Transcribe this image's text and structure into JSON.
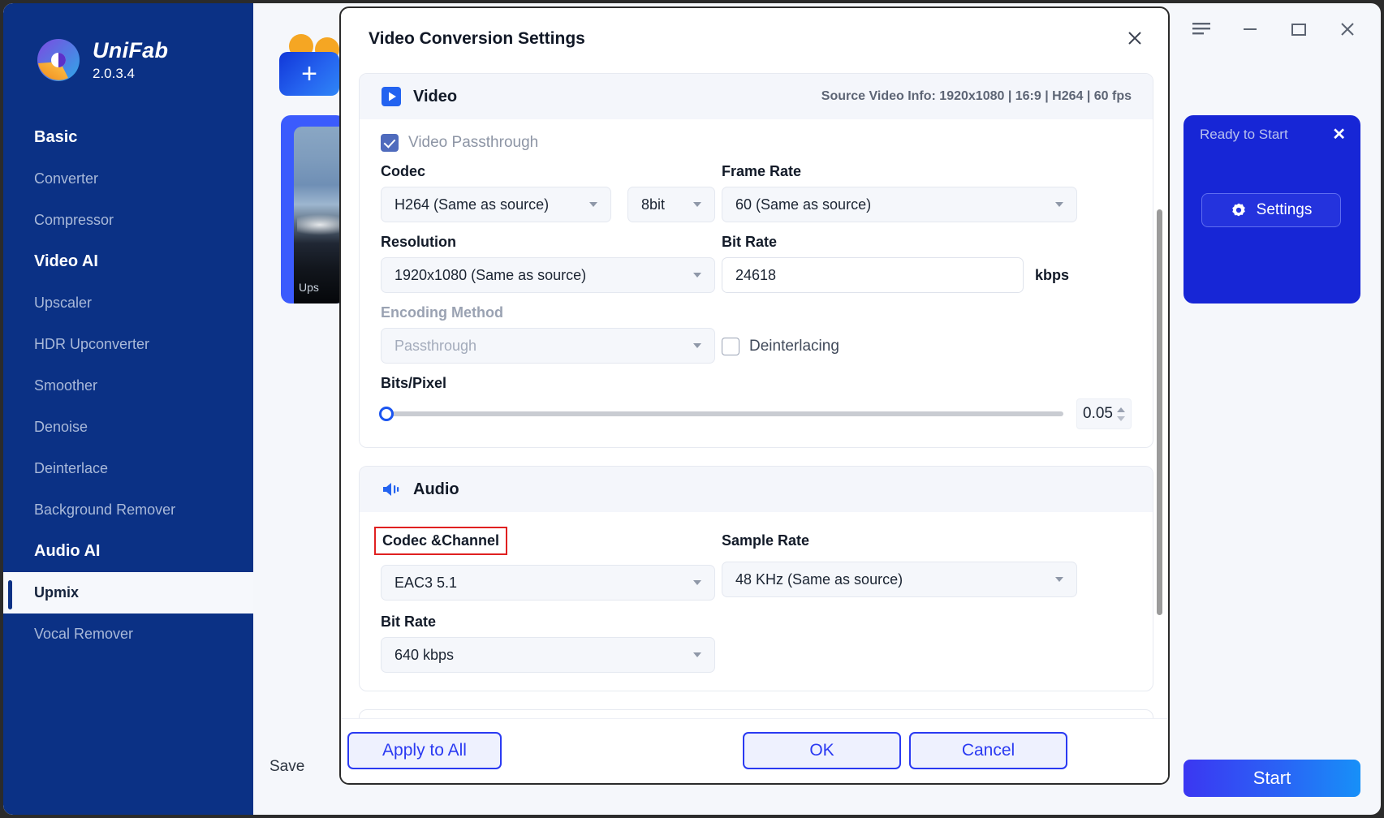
{
  "app": {
    "brand_name": "UniFab",
    "version": "2.0.3.4"
  },
  "titlebar": {
    "menu_icon": "hamburger-menu-icon",
    "minimize_icon": "minimize-icon",
    "maximize_icon": "maximize-icon",
    "close_icon": "close-icon"
  },
  "sidebar": {
    "groups": [
      {
        "label": "Basic",
        "items": [
          {
            "label": "Converter",
            "active": false
          },
          {
            "label": "Compressor",
            "active": false
          }
        ]
      },
      {
        "label": "Video AI",
        "items": [
          {
            "label": "Upscaler",
            "active": false
          },
          {
            "label": "HDR Upconverter",
            "active": false
          },
          {
            "label": "Smoother",
            "active": false
          },
          {
            "label": "Denoise",
            "active": false
          },
          {
            "label": "Deinterlace",
            "active": false
          },
          {
            "label": "Background Remover",
            "active": false
          }
        ]
      },
      {
        "label": "Audio AI",
        "items": [
          {
            "label": "Upmix",
            "active": true
          },
          {
            "label": "Vocal Remover",
            "active": false
          }
        ]
      }
    ]
  },
  "content": {
    "add_button_label": "+",
    "task_card_label": "Ups",
    "save_label": "Save",
    "ready_panel": {
      "title": "Ready to Start",
      "close_icon": "close-icon",
      "settings_label": "Settings",
      "settings_icon": "gear-icon"
    },
    "start_label": "Start"
  },
  "dialog": {
    "title": "Video Conversion Settings",
    "close_icon": "close-icon",
    "video": {
      "section_title": "Video",
      "section_icon": "video-play-icon",
      "source_info": "Source Video Info: 1920x1080 | 16:9 | H264 | 60 fps",
      "passthrough_label": "Video Passthrough",
      "passthrough_checked": true,
      "codec_label": "Codec",
      "codec_value": "H264 (Same as source)",
      "bitdepth_value": "8bit",
      "framerate_label": "Frame Rate",
      "framerate_value": "60 (Same as source)",
      "resolution_label": "Resolution",
      "resolution_value": "1920x1080 (Same as source)",
      "bitrate_label": "Bit Rate",
      "bitrate_value": "24618",
      "bitrate_unit": "kbps",
      "encoding_label": "Encoding Method",
      "encoding_value": "Passthrough",
      "deinterlacing_label": "Deinterlacing",
      "deinterlacing_checked": false,
      "bitspixel_label": "Bits/Pixel",
      "bitspixel_value": "0.05"
    },
    "audio": {
      "section_title": "Audio",
      "section_icon": "speaker-icon",
      "codec_channel_label": "Codec &Channel",
      "codec_channel_value": "EAC3 5.1",
      "sample_rate_label": "Sample Rate",
      "sample_rate_value": "48 KHz (Same as source)",
      "bitrate_label": "Bit Rate",
      "bitrate_value": "640 kbps"
    },
    "footer": {
      "apply_all_label": "Apply to All",
      "ok_label": "OK",
      "cancel_label": "Cancel"
    }
  },
  "colors": {
    "sidebar_bg": "#0b3185",
    "accent_blue": "#2a3af2",
    "highlight_red": "#e02020",
    "panel_blue": "#1726d6"
  }
}
